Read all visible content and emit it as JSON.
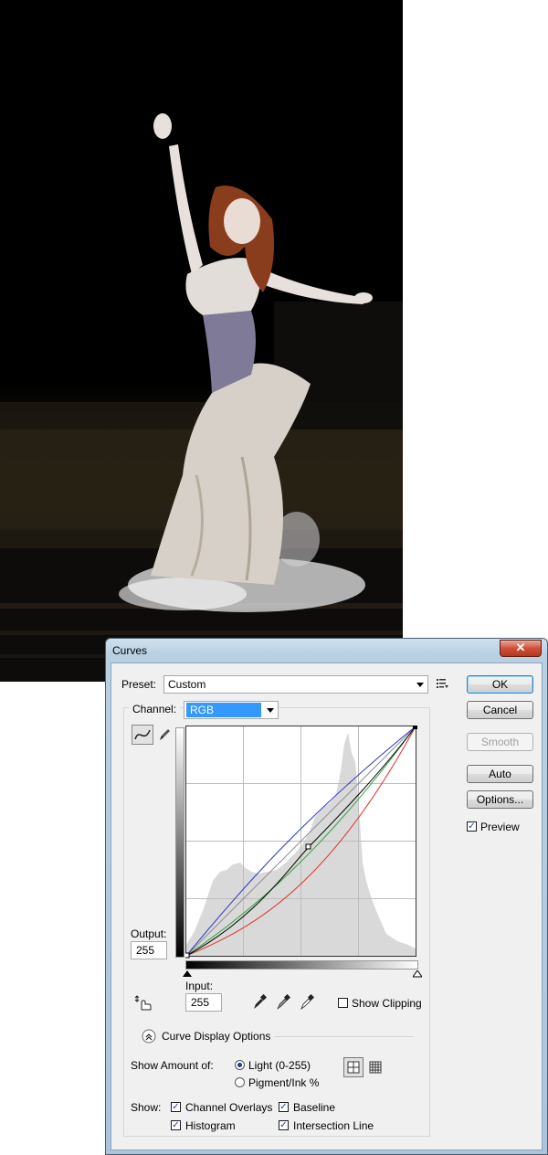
{
  "dialog": {
    "title": "Curves",
    "close_glyph": "✕",
    "preset": {
      "label": "Preset:",
      "value": "Custom"
    },
    "channel": {
      "label": "Channel:",
      "value": "RGB"
    },
    "buttons": {
      "ok": "OK",
      "cancel": "Cancel",
      "smooth": "Smooth",
      "auto": "Auto",
      "options": "Options..."
    },
    "preview": {
      "label": "Preview",
      "checked": true
    },
    "output": {
      "label": "Output:",
      "value": "255"
    },
    "input": {
      "label": "Input:",
      "value": "255"
    },
    "show_clipping": {
      "label": "Show Clipping",
      "checked": false
    },
    "display_options": {
      "label": "Curve Display Options"
    },
    "show_amount": {
      "label": "Show Amount of:",
      "light": "Light  (0-255)",
      "pigment": "Pigment/Ink %",
      "selected": "light"
    },
    "show": {
      "label": "Show:",
      "channel_overlays": "Channel Overlays",
      "baseline": "Baseline",
      "histogram": "Histogram",
      "intersection_line": "Intersection Line"
    },
    "icons": {
      "preset_menu": "preset-options-icon",
      "curve_tool": "curve-tool-icon",
      "pencil_tool": "pencil-tool-icon",
      "hand_tool": "on-image-adjust-icon",
      "black_eyedropper": "black-point-eyedropper-icon",
      "gray_eyedropper": "gray-point-eyedropper-icon",
      "white_eyedropper": "white-point-eyedropper-icon",
      "grid_simple": "grid-4x4-icon",
      "grid_detailed": "grid-10x10-icon"
    },
    "colors": {
      "red_curve": "#e0302a",
      "green_curve": "#2fa33a",
      "blue_curve": "#2a36c8",
      "rgb_curve": "#000000",
      "accent": "#3399ff"
    }
  }
}
